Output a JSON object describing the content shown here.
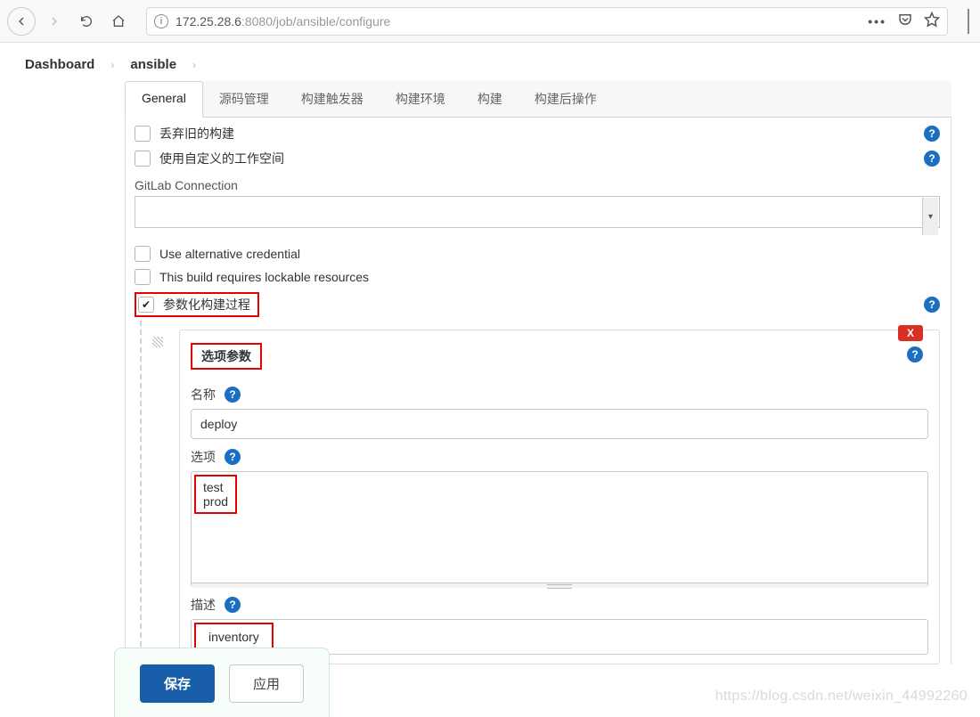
{
  "browser": {
    "url_host": "172.25.28.6",
    "url_port_path": ":8080/job/ansible/configure"
  },
  "crumbs": {
    "dashboard": "Dashboard",
    "job": "ansible"
  },
  "tabs": {
    "general": "General",
    "scm": "源码管理",
    "triggers": "构建触发器",
    "env": "构建环境",
    "build": "构建",
    "post": "构建后操作"
  },
  "options": {
    "discard_old": "丢弃旧的构建",
    "custom_ws": "使用自定义的工作空间",
    "gitlab_conn_label": "GitLab Connection",
    "gitlab_conn_value": "",
    "alt_cred": "Use alternative credential",
    "lockable": "This build requires lockable resources",
    "parameterized": "参数化构建过程"
  },
  "param": {
    "title": "选项参数",
    "x": "X",
    "name_label": "名称",
    "name_value": "deploy",
    "options_label": "选项",
    "options_value": "test\nprod",
    "desc_label": "描述",
    "desc_value": "inventory"
  },
  "footer": {
    "save": "保存",
    "apply": "应用"
  },
  "watermark": "https://blog.csdn.net/weixin_44992260"
}
